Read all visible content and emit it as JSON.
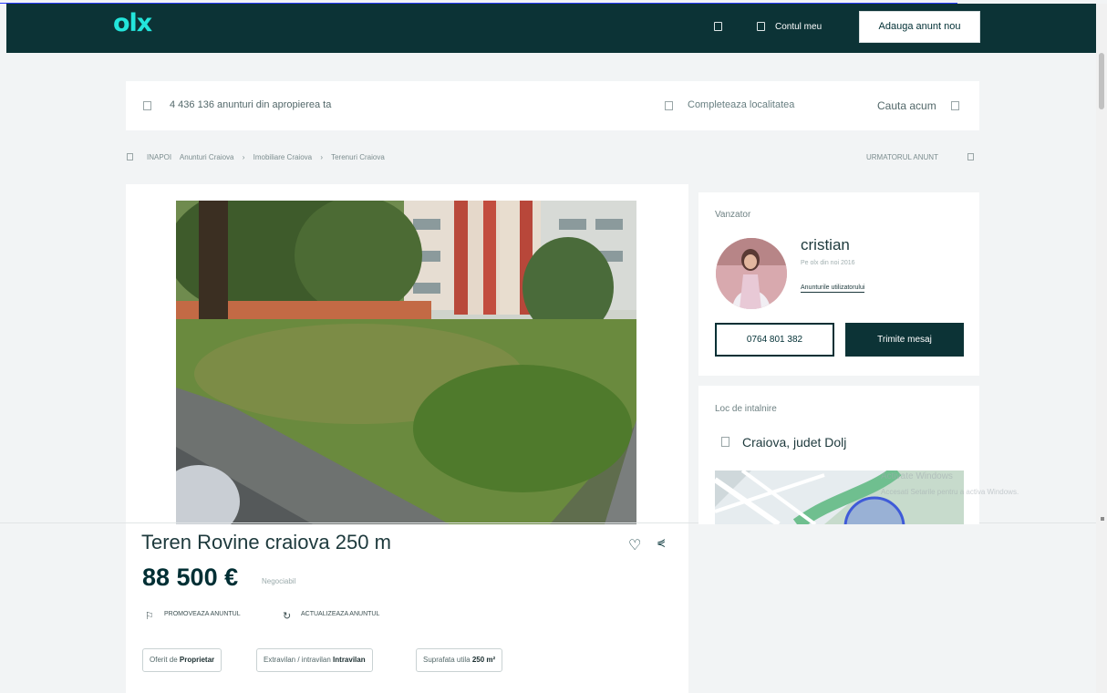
{
  "header": {
    "logo": "olx",
    "account_label": "Contul meu",
    "post_button": "Adauga anunt nou"
  },
  "search": {
    "ad_count": "4 436 136 anunturi din apropierea ta",
    "location_placeholder": "Completeaza localitatea",
    "search_button": "Cauta acum"
  },
  "breadcrumb": {
    "back": "INAPOI",
    "items": [
      "Anunturi Craiova",
      "Imobiliare Craiova",
      "Terenuri Craiova"
    ],
    "separator": "›",
    "next_ad": "URMATORUL ANUNT"
  },
  "listing": {
    "title": "Teren Rovine craiova 250 m",
    "price": "88 500 €",
    "price_note": "Negociabil",
    "actions": {
      "promote": "PROMOVEAZA ANUNTUL",
      "refresh": "ACTUALIZEAZA ANUNTUL"
    },
    "tags": [
      {
        "label": "Oferit de",
        "value": "Proprietar"
      },
      {
        "label": "Extravilan / intravilan",
        "value": "Intravilan"
      },
      {
        "label": "Suprafata utila",
        "value": "250 m²"
      }
    ]
  },
  "seller": {
    "heading": "Vanzator",
    "name": "cristian",
    "since": "Pe olx din noi 2016",
    "ads_link": "Anunturile utilizatorului",
    "phone": "0764 801 382",
    "message_button": "Trimite mesaj"
  },
  "location": {
    "heading": "Loc de intalnire",
    "value": "Craiova, judet Dolj"
  },
  "overlay": {
    "line1": "Activate Windows",
    "line2": "Accesati Setarile pentru a activa Windows."
  },
  "colors": {
    "header_bg": "#0c3336",
    "logo": "#23e5db",
    "primary": "#002f34"
  }
}
